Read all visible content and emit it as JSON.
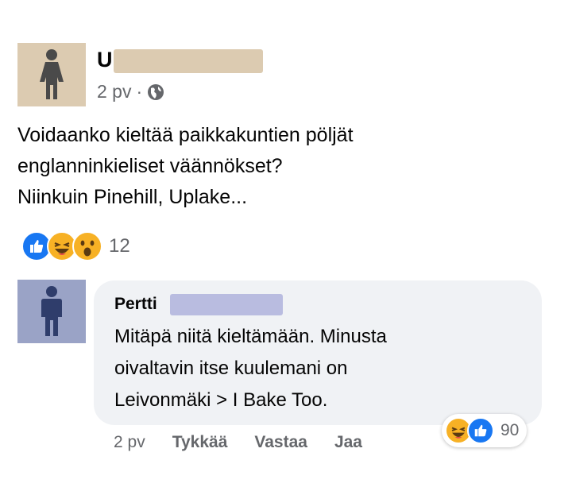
{
  "post": {
    "author_visible": "U",
    "time": "2 pv",
    "separator": "·",
    "privacy_icon": "globe-icon",
    "text_lines": [
      "Voidaanko kieltää paikkakuntien pöljät",
      "englanninkieliset väännökset?",
      "Niinkuin Pinehill, Uplake..."
    ],
    "reactions": [
      "like",
      "haha",
      "wow"
    ],
    "reaction_count": "12"
  },
  "comment": {
    "author_visible": "Pertti",
    "text_lines": [
      "Mitäpä niitä kieltämään. Minusta",
      "oivaltavin itse kuulemani on",
      "Leivonmäki > I Bake Too."
    ],
    "time": "2 pv",
    "like_label": "Tykkää",
    "reply_label": "Vastaa",
    "share_label": "Jaa",
    "reactions": [
      "haha",
      "like"
    ],
    "reaction_count": "90"
  },
  "colors": {
    "like": "#1877f2",
    "emoji": "#f7b125",
    "bubble": "#f0f2f5",
    "avatar_female": "#dccbb1",
    "avatar_male": "#9aa3c6"
  }
}
